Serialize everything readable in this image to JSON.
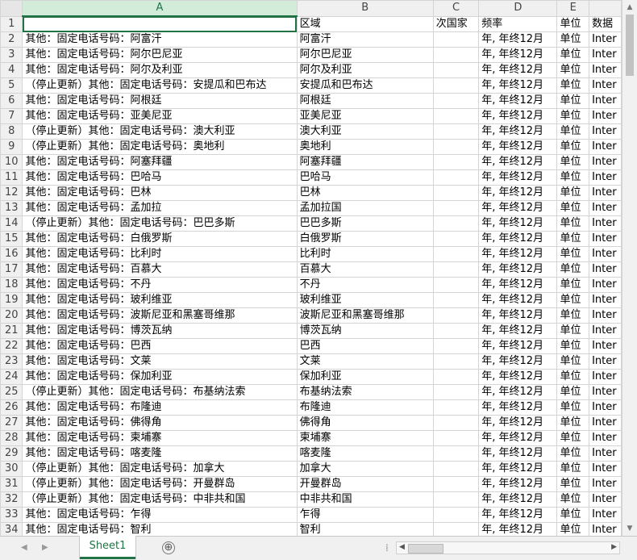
{
  "columns": [
    {
      "letter": "A",
      "selected": true
    },
    {
      "letter": "B",
      "selected": false
    },
    {
      "letter": "C",
      "selected": false
    },
    {
      "letter": "D",
      "selected": false
    },
    {
      "letter": "E",
      "selected": false
    },
    {
      "letter": "",
      "selected": false
    }
  ],
  "header_row": {
    "num": "1",
    "a": "",
    "b": "区域",
    "c": "次国家",
    "d": "频率",
    "e": "单位",
    "f": "数据"
  },
  "rows": [
    {
      "num": "2",
      "a": "其他：固定电话号码：阿富汗",
      "b": "阿富汗",
      "c": "",
      "d": "年, 年终12月",
      "e": "单位",
      "f": "Inter"
    },
    {
      "num": "3",
      "a": "其他：固定电话号码：阿尔巴尼亚",
      "b": "阿尔巴尼亚",
      "c": "",
      "d": "年, 年终12月",
      "e": "单位",
      "f": "Inter"
    },
    {
      "num": "4",
      "a": "其他：固定电话号码：阿尔及利亚",
      "b": "阿尔及利亚",
      "c": "",
      "d": "年, 年终12月",
      "e": "单位",
      "f": "Inter"
    },
    {
      "num": "5",
      "a": "（停止更新）其他：固定电话号码：安提瓜和巴布达",
      "b": "安提瓜和巴布达",
      "c": "",
      "d": "年, 年终12月",
      "e": "单位",
      "f": "Inter"
    },
    {
      "num": "6",
      "a": "其他：固定电话号码：阿根廷",
      "b": "阿根廷",
      "c": "",
      "d": "年, 年终12月",
      "e": "单位",
      "f": "Inter"
    },
    {
      "num": "7",
      "a": "其他：固定电话号码：亚美尼亚",
      "b": "亚美尼亚",
      "c": "",
      "d": "年, 年终12月",
      "e": "单位",
      "f": "Inter"
    },
    {
      "num": "8",
      "a": "（停止更新）其他：固定电话号码：澳大利亚",
      "b": "澳大利亚",
      "c": "",
      "d": "年, 年终12月",
      "e": "单位",
      "f": "Inter"
    },
    {
      "num": "9",
      "a": "（停止更新）其他：固定电话号码：奥地利",
      "b": "奥地利",
      "c": "",
      "d": "年, 年终12月",
      "e": "单位",
      "f": "Inter"
    },
    {
      "num": "10",
      "a": "其他：固定电话号码：阿塞拜疆",
      "b": "阿塞拜疆",
      "c": "",
      "d": "年, 年终12月",
      "e": "单位",
      "f": "Inter"
    },
    {
      "num": "11",
      "a": "其他：固定电话号码：巴哈马",
      "b": "巴哈马",
      "c": "",
      "d": "年, 年终12月",
      "e": "单位",
      "f": "Inter"
    },
    {
      "num": "12",
      "a": "其他：固定电话号码：巴林",
      "b": "巴林",
      "c": "",
      "d": "年, 年终12月",
      "e": "单位",
      "f": "Inter"
    },
    {
      "num": "13",
      "a": "其他：固定电话号码：孟加拉",
      "b": "孟加拉国",
      "c": "",
      "d": "年, 年终12月",
      "e": "单位",
      "f": "Inter"
    },
    {
      "num": "14",
      "a": "（停止更新）其他：固定电话号码：巴巴多斯",
      "b": "巴巴多斯",
      "c": "",
      "d": "年, 年终12月",
      "e": "单位",
      "f": "Inter"
    },
    {
      "num": "15",
      "a": "其他：固定电话号码：白俄罗斯",
      "b": "白俄罗斯",
      "c": "",
      "d": "年, 年终12月",
      "e": "单位",
      "f": "Inter"
    },
    {
      "num": "16",
      "a": "其他：固定电话号码：比利时",
      "b": "比利时",
      "c": "",
      "d": "年, 年终12月",
      "e": "单位",
      "f": "Inter"
    },
    {
      "num": "17",
      "a": "其他：固定电话号码：百慕大",
      "b": "百慕大",
      "c": "",
      "d": "年, 年终12月",
      "e": "单位",
      "f": "Inter"
    },
    {
      "num": "18",
      "a": "其他：固定电话号码：不丹",
      "b": "不丹",
      "c": "",
      "d": "年, 年终12月",
      "e": "单位",
      "f": "Inter"
    },
    {
      "num": "19",
      "a": "其他：固定电话号码：玻利维亚",
      "b": "玻利维亚",
      "c": "",
      "d": "年, 年终12月",
      "e": "单位",
      "f": "Inter"
    },
    {
      "num": "20",
      "a": "其他：固定电话号码：波斯尼亚和黑塞哥维那",
      "b": "波斯尼亚和黑塞哥维那",
      "c": "",
      "d": "年, 年终12月",
      "e": "单位",
      "f": "Inter"
    },
    {
      "num": "21",
      "a": "其他：固定电话号码：博茨瓦纳",
      "b": "博茨瓦纳",
      "c": "",
      "d": "年, 年终12月",
      "e": "单位",
      "f": "Inter"
    },
    {
      "num": "22",
      "a": "其他：固定电话号码：巴西",
      "b": "巴西",
      "c": "",
      "d": "年, 年终12月",
      "e": "单位",
      "f": "Inter"
    },
    {
      "num": "23",
      "a": "其他：固定电话号码：文莱",
      "b": "文莱",
      "c": "",
      "d": "年, 年终12月",
      "e": "单位",
      "f": "Inter"
    },
    {
      "num": "24",
      "a": "其他：固定电话号码：保加利亚",
      "b": "保加利亚",
      "c": "",
      "d": "年, 年终12月",
      "e": "单位",
      "f": "Inter"
    },
    {
      "num": "25",
      "a": "（停止更新）其他：固定电话号码：布基纳法索",
      "b": "布基纳法索",
      "c": "",
      "d": "年, 年终12月",
      "e": "单位",
      "f": "Inter"
    },
    {
      "num": "26",
      "a": "其他：固定电话号码：布隆迪",
      "b": "布隆迪",
      "c": "",
      "d": "年, 年终12月",
      "e": "单位",
      "f": "Inter"
    },
    {
      "num": "27",
      "a": "其他：固定电话号码：佛得角",
      "b": "佛得角",
      "c": "",
      "d": "年, 年终12月",
      "e": "单位",
      "f": "Inter"
    },
    {
      "num": "28",
      "a": "其他：固定电话号码：柬埔寨",
      "b": "柬埔寨",
      "c": "",
      "d": "年, 年终12月",
      "e": "单位",
      "f": "Inter"
    },
    {
      "num": "29",
      "a": "其他：固定电话号码：喀麦隆",
      "b": "喀麦隆",
      "c": "",
      "d": "年, 年终12月",
      "e": "单位",
      "f": "Inter"
    },
    {
      "num": "30",
      "a": "（停止更新）其他：固定电话号码：加拿大",
      "b": "加拿大",
      "c": "",
      "d": "年, 年终12月",
      "e": "单位",
      "f": "Inter"
    },
    {
      "num": "31",
      "a": "（停止更新）其他：固定电话号码：开曼群岛",
      "b": "开曼群岛",
      "c": "",
      "d": "年, 年终12月",
      "e": "单位",
      "f": "Inter"
    },
    {
      "num": "32",
      "a": "（停止更新）其他：固定电话号码：中非共和国",
      "b": "中非共和国",
      "c": "",
      "d": "年, 年终12月",
      "e": "单位",
      "f": "Inter"
    },
    {
      "num": "33",
      "a": "其他：固定电话号码：乍得",
      "b": "乍得",
      "c": "",
      "d": "年, 年终12月",
      "e": "单位",
      "f": "Inter"
    },
    {
      "num": "34",
      "a": "其他：固定电话号码：智利",
      "b": "智利",
      "c": "",
      "d": "年, 年终12月",
      "e": "单位",
      "f": "Inter"
    }
  ],
  "sheet_tabs": [
    {
      "label": "Sheet1",
      "active": true
    }
  ],
  "bottom": {
    "add_sheet_glyph": "⊕",
    "split_glyph": "⁞"
  },
  "icons": {
    "nav_prev": "◀",
    "nav_next": "▶",
    "scroll_up": "▲",
    "scroll_down": "▼",
    "scroll_left": "◀",
    "scroll_right": "▶"
  },
  "theme": {
    "accent": "#217346",
    "header_bg": "#f0f0f0",
    "gridline": "#d4d4d4"
  }
}
